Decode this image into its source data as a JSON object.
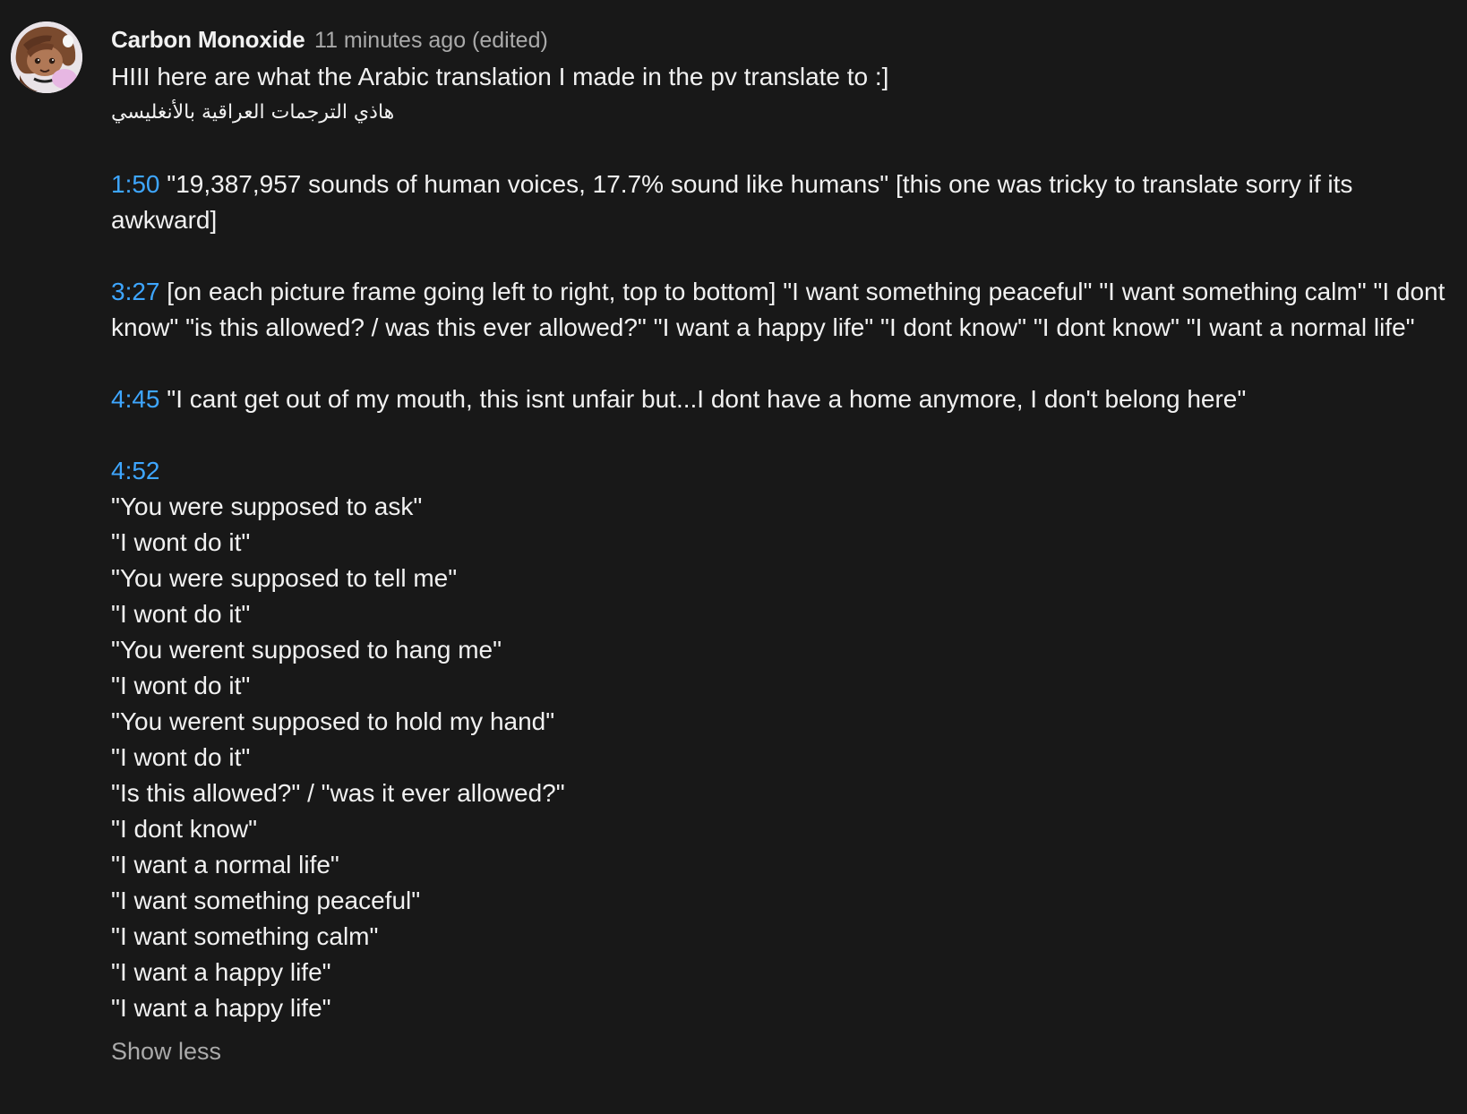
{
  "comment": {
    "author": "Carbon Monoxide",
    "meta": "11 minutes ago (edited)",
    "intro_line": "HIII here are what the Arabic translation I made in the pv translate to :]",
    "arabic_line": "هاذي الترجمات العراقية بالأنغليسي",
    "entries": [
      {
        "timestamp": "1:50",
        "text": "\"19,387,957 sounds of human voices, 17.7% sound like humans\" [this one was tricky to translate sorry if its awkward]"
      },
      {
        "timestamp": "3:27",
        "text": "[on each picture frame going left to right, top to bottom] \"I want something peaceful\" \"I want something calm\" \"I dont know\" \"is this allowed? / was this ever allowed?\" \"I want a happy life\" \"I dont know\" \"I dont know\" \"I want a normal life\""
      },
      {
        "timestamp": "4:45",
        "text": "\"I cant get out of my mouth, this isnt unfair but...I dont have a home anymore, I don't belong here\""
      },
      {
        "timestamp": "4:52",
        "text": ""
      }
    ],
    "lyrics": [
      "\"You were supposed to ask\"",
      "\"I wont do it\"",
      "\"You were supposed to tell me\"",
      "\"I wont do it\"",
      "\"You werent supposed to hang me\"",
      "\"I wont do it\"",
      "\"You werent supposed to hold my hand\"",
      "\"I wont do it\"",
      "\"Is this allowed?\" / \"was it ever allowed?\"",
      "\"I dont know\"",
      "\"I want a normal life\"",
      "\"I want something peaceful\"",
      "\"I want something calm\"",
      "\"I want a happy life\"",
      "\"I want a happy life\""
    ],
    "show_less_label": "Show less"
  },
  "colors": {
    "background": "#181818",
    "text": "#f1f1f1",
    "meta": "#aaaaaa",
    "timestamp_link": "#3ea6ff"
  },
  "icons": {
    "avatar": "avatar-drawing"
  }
}
